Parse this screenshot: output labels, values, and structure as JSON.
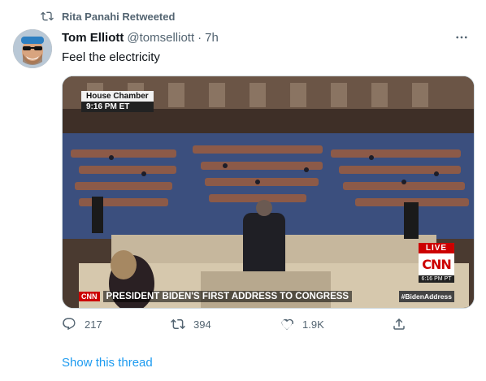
{
  "social_context": {
    "text": "Rita Panahi Retweeted",
    "icon": "retweet-icon"
  },
  "tweet": {
    "author_name": "Tom Elliott",
    "author_handle": "@tomselliott",
    "separator": "·",
    "time": "7h",
    "text": "Feel the electricity",
    "more_icon": "more-icon"
  },
  "media": {
    "location_label": "House Chamber",
    "time_label": "9:16 PM ET",
    "live_label": "LIVE",
    "network_logo": "CNN",
    "network_time": "6:16 PM PT",
    "ticker_logo": "CNN",
    "headline": "PRESIDENT BIDEN'S FIRST ADDRESS TO CONGRESS",
    "hashtag": "#BidenAddress"
  },
  "actions": {
    "reply_count": "217",
    "retweet_count": "394",
    "like_count": "1.9K"
  },
  "show_thread": "Show this thread",
  "colors": {
    "accent": "#1d9bf0",
    "secondary_text": "#536471",
    "cnn_red": "#cc0000"
  }
}
